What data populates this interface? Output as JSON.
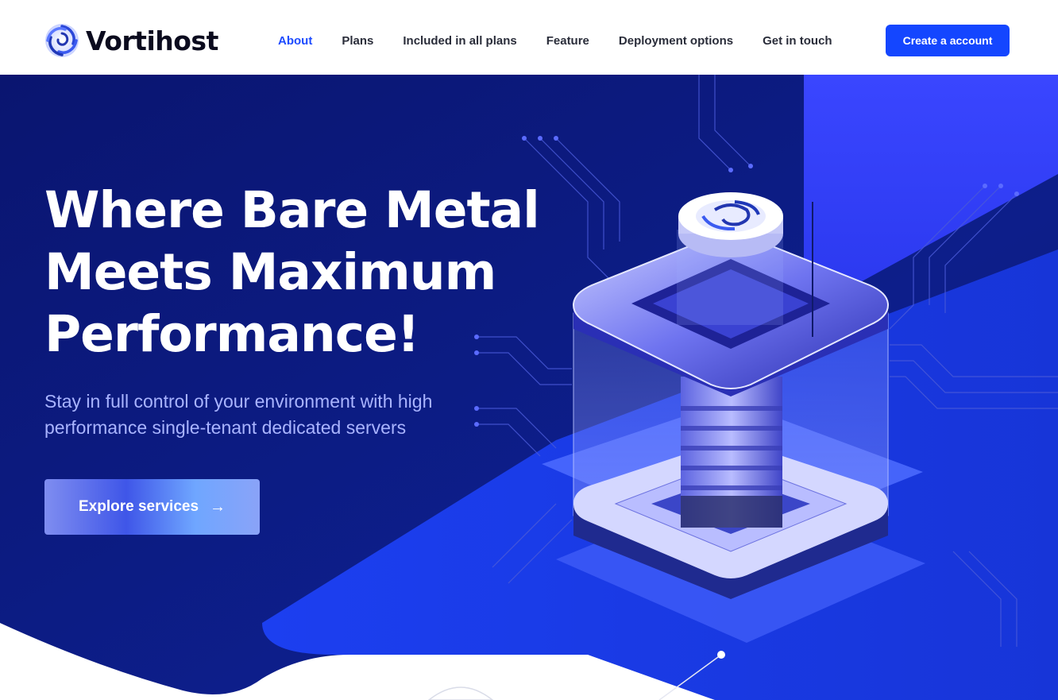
{
  "brand": {
    "name": "Vortihost",
    "logo_icon": "vortex-logo-icon"
  },
  "nav": {
    "items": [
      {
        "label": "About",
        "active": true
      },
      {
        "label": "Plans",
        "active": false
      },
      {
        "label": "Included in all plans",
        "active": false
      },
      {
        "label": "Feature",
        "active": false
      },
      {
        "label": "Deployment options",
        "active": false
      },
      {
        "label": "Get in touch",
        "active": false
      }
    ],
    "cta_label": "Create a account"
  },
  "hero": {
    "title_lines": [
      "Where Bare Metal",
      "Meets Maximum",
      "Performance!"
    ],
    "subtitle": "Stay in full control of your environment with high performance single-tenant dedicated servers",
    "button_label": "Explore services",
    "button_icon": "arrow-right-icon"
  },
  "colors": {
    "accent": "#1446ff",
    "hero_bg": "#0b1a7a",
    "hero_panel": "#3344ff",
    "subtitle": "#a9b4ff"
  }
}
